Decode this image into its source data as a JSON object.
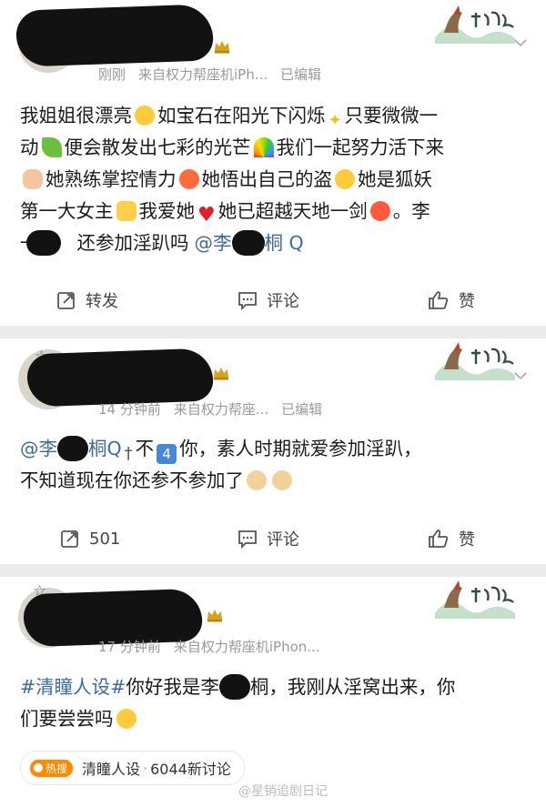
{
  "posts": [
    {
      "meta": {
        "time": "刚刚",
        "source": "来自权力帮座机iPh...",
        "edited": "已编辑"
      },
      "lines": {
        "l1a": "我姐姐很漂亮",
        "l1b": "如宝石在阳光下闪烁",
        "l1c": "只要微微一",
        "l2a": "动",
        "l2b": "便会散发出七彩的光芒",
        "l2c": "我们一起努力活下来",
        "l3a": "她熟练掌控情力",
        "l3b": "她悟出自己的盗",
        "l3c": "她是狐妖",
        "l4a": "第一大女主",
        "l4b": "我爱她",
        "l4c": "她已超越天地一剑",
        "l4d": "。李",
        "l5a": "一",
        "l5b": "还参加淫趴吗",
        "l5c": "@李",
        "l5d": "桐",
        "l5e": "Q"
      },
      "actions": {
        "repost": "转发",
        "comment": "评论",
        "like": "赞"
      }
    },
    {
      "meta": {
        "time": "14 分钟前",
        "source": "来自权力帮座...",
        "edited": "已编辑"
      },
      "lines": {
        "l1a": "@李",
        "l1b": "桐Q",
        "l1c": "不",
        "l1d": "4",
        "l1e": "你，素人时期就爱参加淫趴，",
        "l2a": "不知道现在你还参不参加了"
      },
      "actions": {
        "repost": "501",
        "comment": "评论",
        "like": "赞"
      }
    },
    {
      "meta": {
        "time": "17 分钟前",
        "source": "来自权力帮座机iPhon..."
      },
      "lines": {
        "hashtag": "#清瞳人设#",
        "l1b": "你好我是李",
        "l1c": "桐，我刚从淫窝出来，你",
        "l2a": "们要尝尝吗"
      },
      "topic": {
        "hot": "热搜",
        "name": "清瞳人设",
        "count": "6044新讨论"
      }
    }
  ],
  "watermark": "@星销追剧日记"
}
